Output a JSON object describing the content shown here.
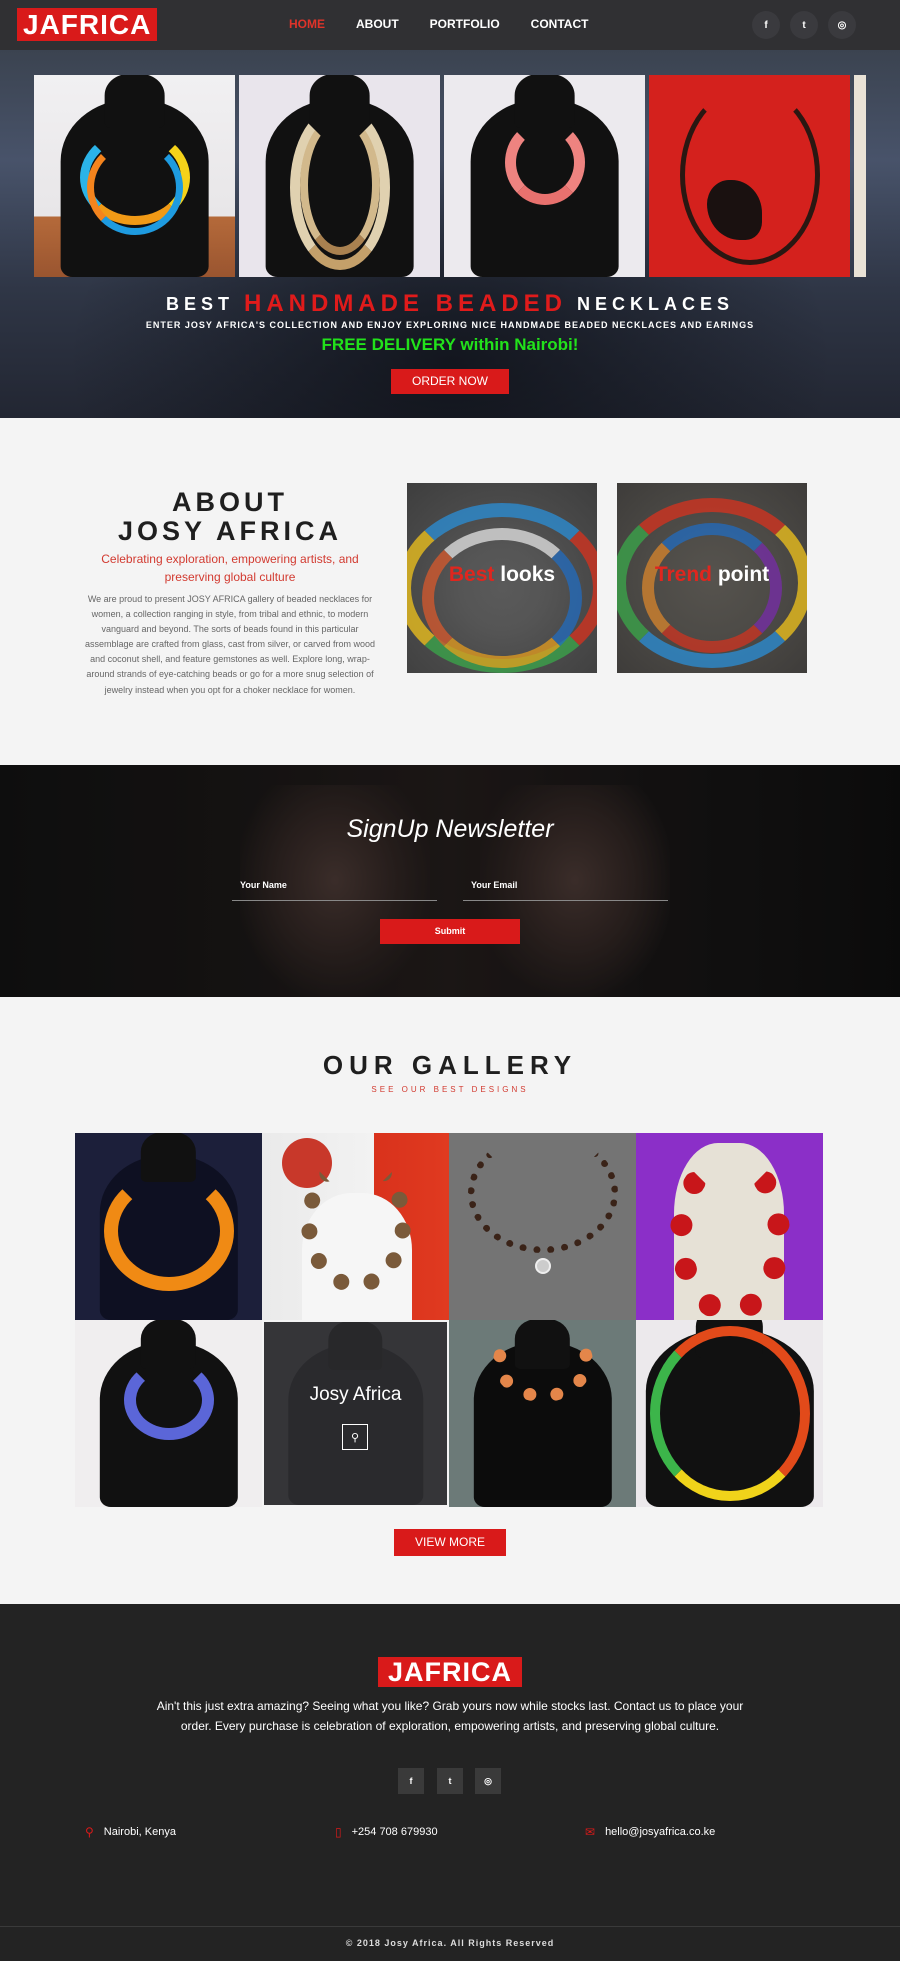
{
  "nav": {
    "logo": "JAFRICA",
    "items": [
      "HOME",
      "ABOUT",
      "PORTFOLIO",
      "CONTACT"
    ],
    "active": "HOME",
    "social": [
      {
        "icon": "facebook-icon",
        "glyph": "f"
      },
      {
        "icon": "twitter-icon",
        "glyph": "t"
      },
      {
        "icon": "instagram-icon",
        "glyph": "◎"
      }
    ]
  },
  "hero": {
    "title_pre": "BEST",
    "title_red": "HANDMADE BEADED",
    "title_post": "NECKLACES",
    "subtitle": "ENTER JOSY AFRICA'S COLLECTION AND ENJOY EXPLORING NICE HANDMADE BEADED NECKLACES AND EARINGS",
    "delivery": "FREE DELIVERY within Nairobi!",
    "cta": "ORDER NOW"
  },
  "about": {
    "title_line1": "ABOUT",
    "title_line2": "JOSY AFRICA",
    "subtitle": "Celebrating exploration, empowering artists, and preserving global culture",
    "body": "We are proud to present JOSY AFRICA gallery of beaded necklaces for women, a collection ranging in style, from tribal and ethnic, to modern vanguard and beyond. The sorts of beads found in this particular assemblage are crafted from glass, cast from silver, or carved from wood and coconut shell, and feature gemstones as well. Explore long, wrap-around strands of eye-catching beads or go for a more snug selection of jewelry instead when you opt for a choker necklace for women.",
    "tiles": [
      {
        "red": "Best",
        "white": "looks"
      },
      {
        "red": "Trend",
        "white": "point"
      }
    ]
  },
  "newsletter": {
    "title": "SignUp Newsletter",
    "name_placeholder": "Your Name",
    "email_placeholder": "Your Email",
    "submit": "Submit"
  },
  "gallery": {
    "title": "OUR GALLERY",
    "subtitle": "SEE OUR BEST DESIGNS",
    "overlay_title": "Josy Africa",
    "view_more": "VIEW MORE"
  },
  "footer": {
    "logo": "JAFRICA",
    "text": "Ain't this just extra amazing? Seeing what you like? Grab yours now while stocks last. Contact us to place your order. Every purchase is celebration of exploration, empowering artists, and preserving global culture.",
    "location": "Nairobi, Kenya",
    "phone": "+254 708 679930",
    "email": "hello@josyafrica.co.ke",
    "copyright": "© 2018 Josy Africa. All Rights Reserved"
  },
  "colors": {
    "accent": "#d91a1a",
    "delivery": "#22e21b",
    "dark": "#232323"
  }
}
